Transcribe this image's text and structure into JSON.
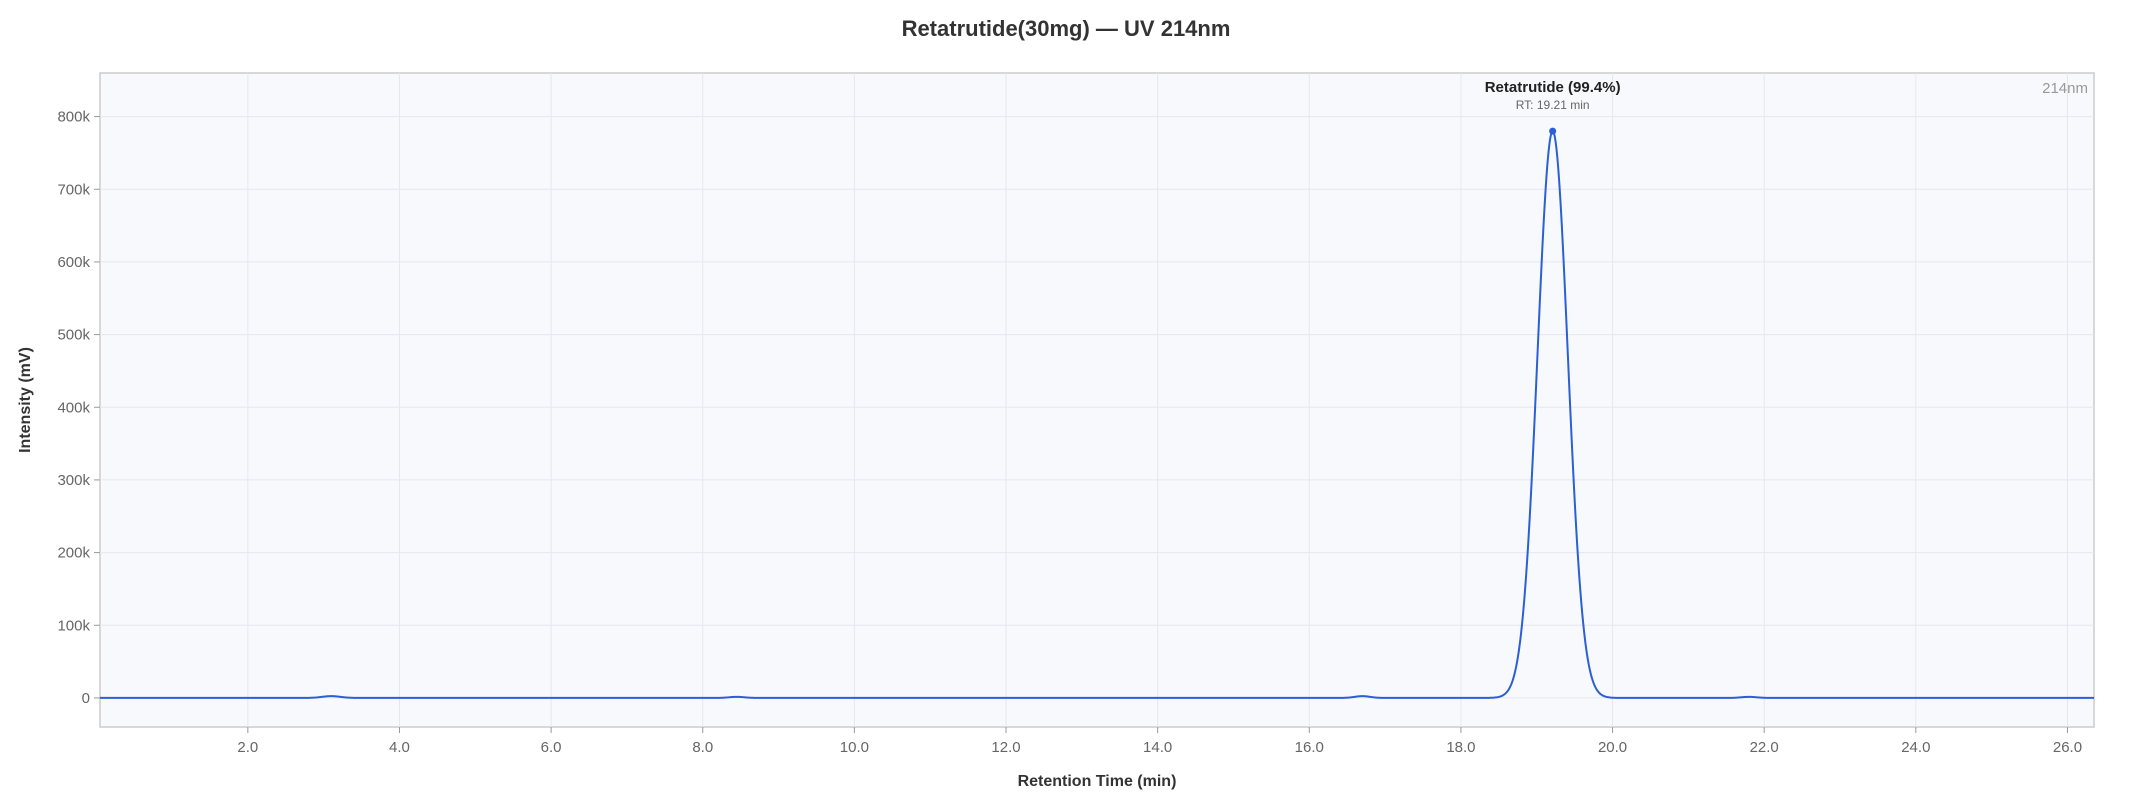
{
  "chart_data": {
    "type": "line",
    "title": "Retatrutide(30mg) — UV 214nm",
    "xlabel": "Retention Time (min)",
    "ylabel": "Intensity (mV)",
    "corner_label": "214nm",
    "xlim": [
      0.05,
      26.35
    ],
    "ylim": [
      -40000,
      860000
    ],
    "x_ticks": [
      2.0,
      4.0,
      6.0,
      8.0,
      10.0,
      12.0,
      14.0,
      16.0,
      18.0,
      20.0,
      22.0,
      24.0,
      26.0
    ],
    "x_tick_labels": [
      "2.0",
      "4.0",
      "6.0",
      "8.0",
      "10.0",
      "12.0",
      "14.0",
      "16.0",
      "18.0",
      "20.0",
      "22.0",
      "24.0",
      "26.0"
    ],
    "y_ticks": [
      0,
      100000,
      200000,
      300000,
      400000,
      500000,
      600000,
      700000,
      800000
    ],
    "y_tick_labels": [
      "0",
      "100k",
      "200k",
      "300k",
      "400k",
      "500k",
      "600k",
      "700k",
      "800k"
    ],
    "grid": true,
    "colors": {
      "line": "#2b5fd6",
      "plot_bg": "#f8f9fc",
      "grid": "#e6e8ee",
      "frame": "#cccccc"
    },
    "baseline": 0,
    "peaks": [
      {
        "rt": 3.1,
        "height": 2500,
        "sigma": 0.12
      },
      {
        "rt": 8.45,
        "height": 1500,
        "sigma": 0.1
      },
      {
        "rt": 16.7,
        "height": 2500,
        "sigma": 0.1
      },
      {
        "rt": 19.21,
        "height": 780000,
        "sigma": 0.2
      },
      {
        "rt": 21.8,
        "height": 1500,
        "sigma": 0.1
      }
    ],
    "annotation": {
      "x": 19.21,
      "y": 780000,
      "label": "Retatrutide (99.4%)",
      "sublabel": "RT: 19.21 min"
    }
  }
}
